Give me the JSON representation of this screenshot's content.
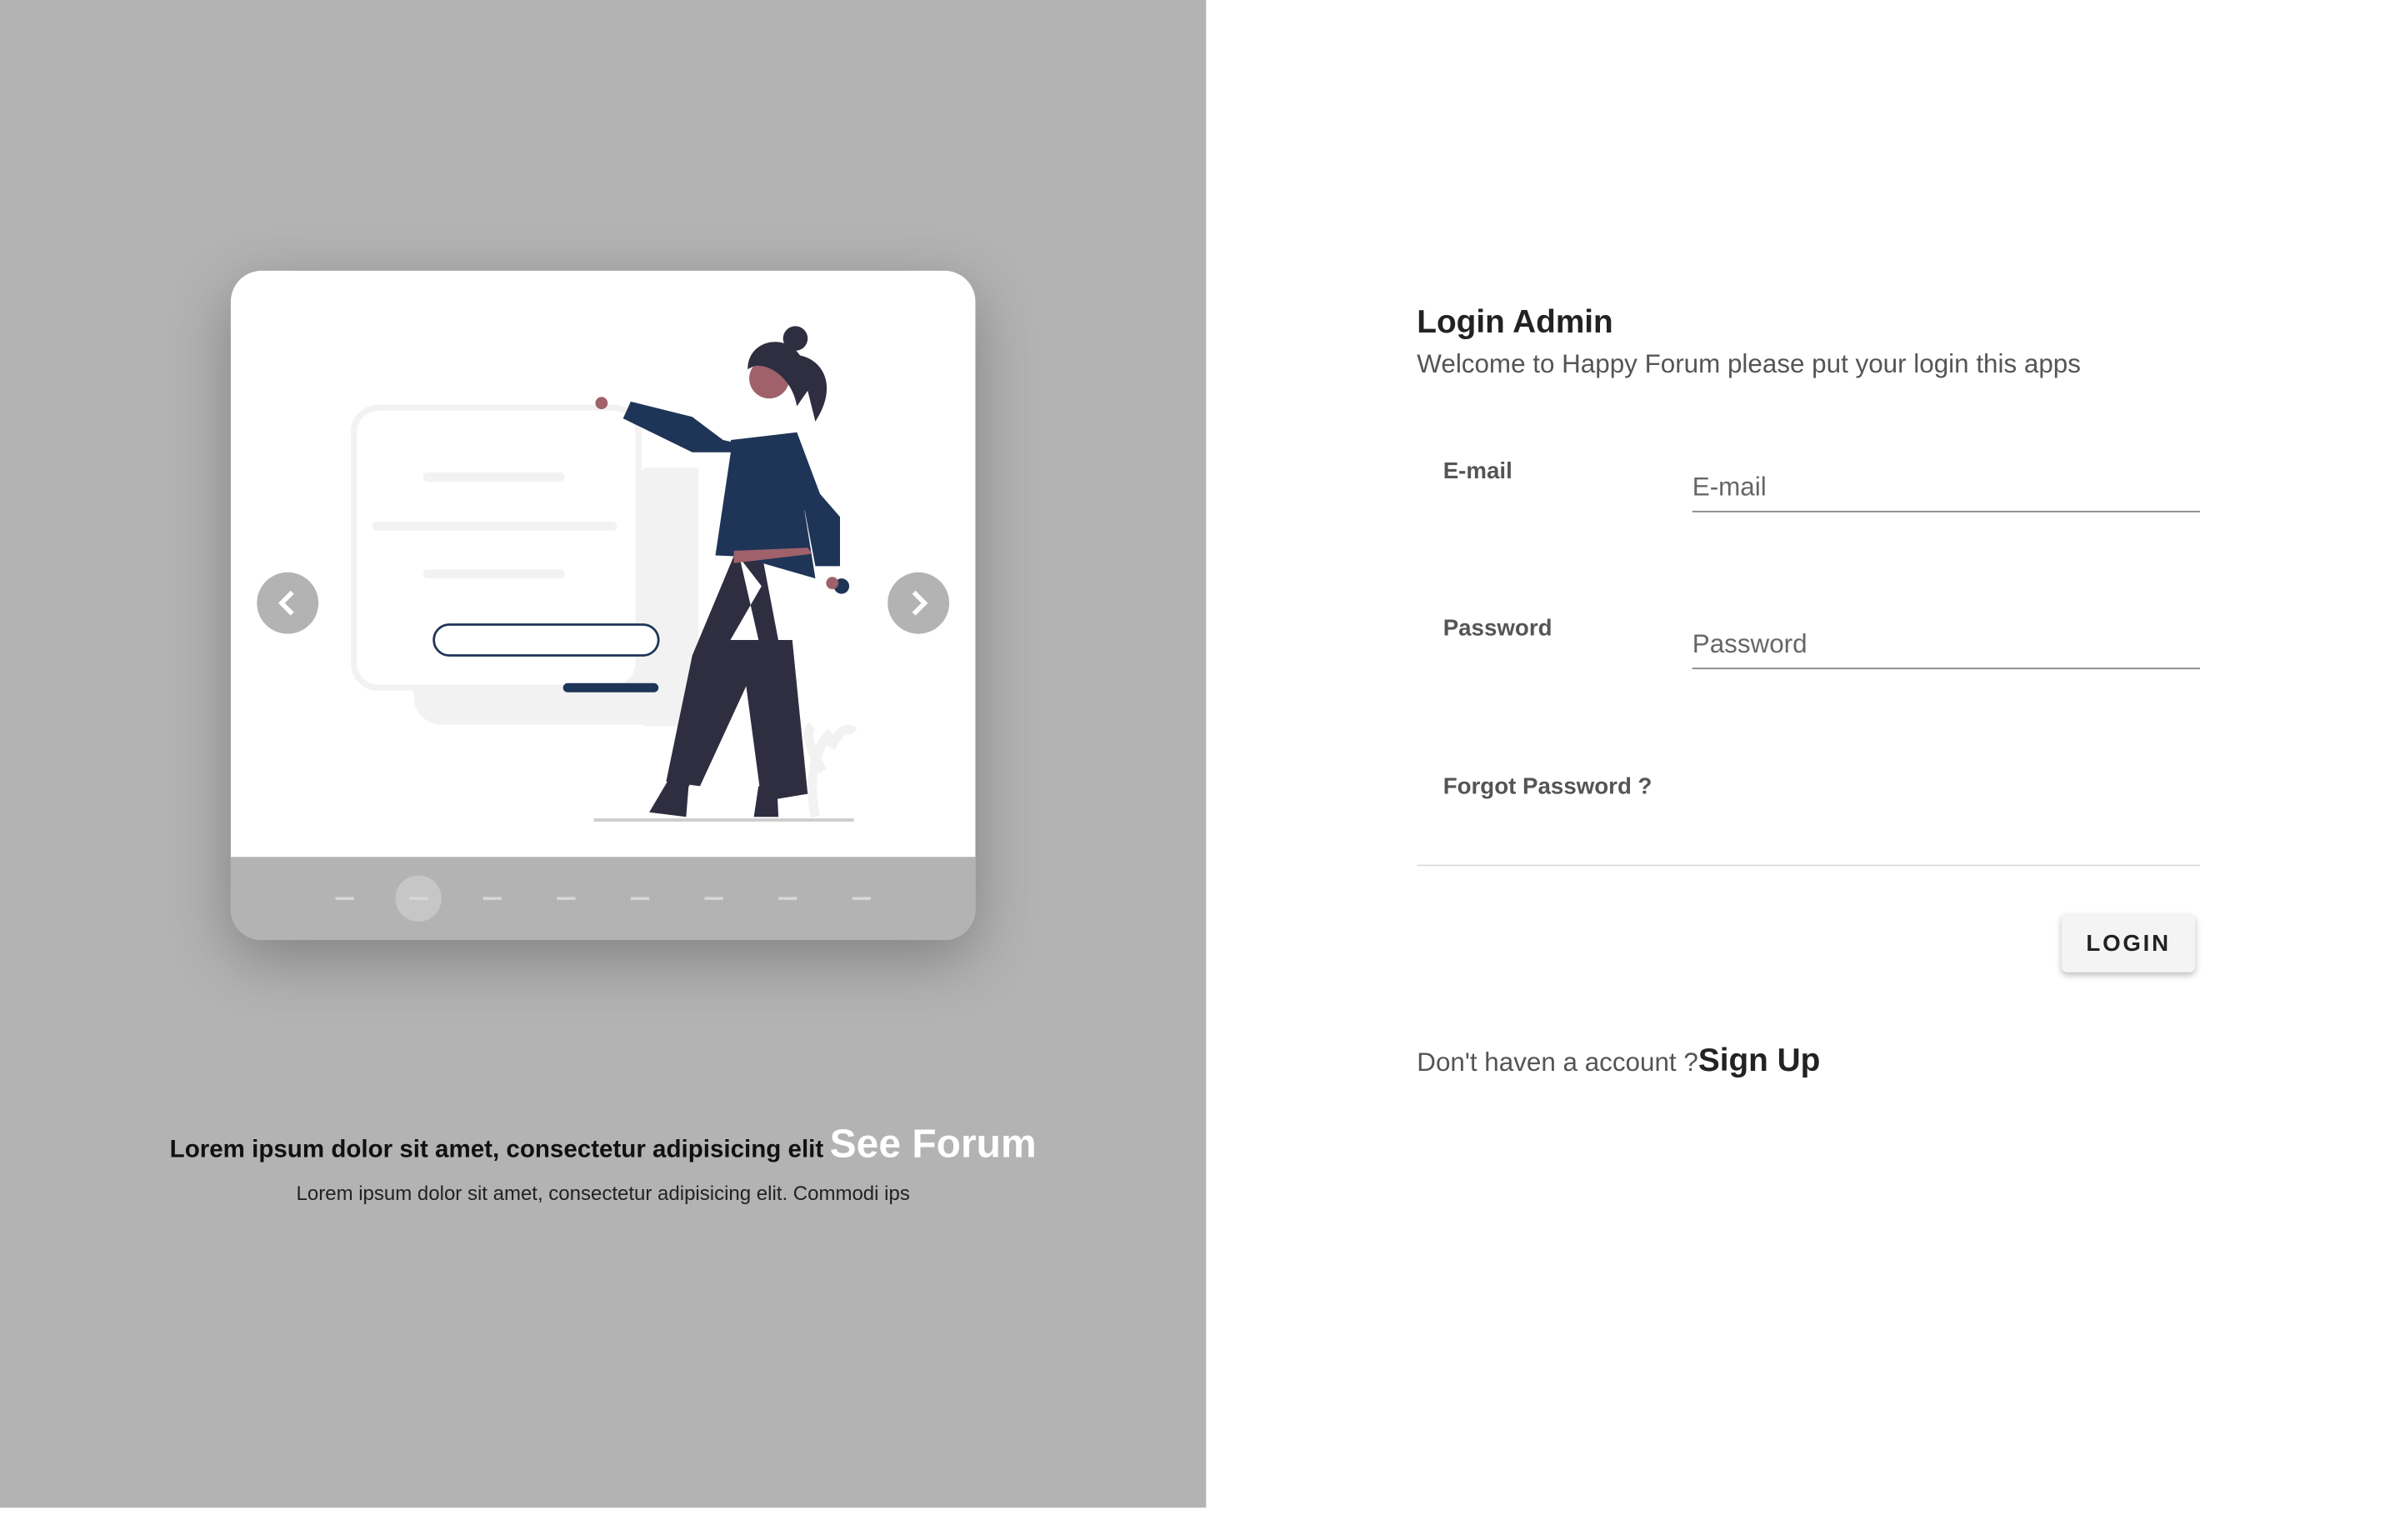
{
  "carousel": {
    "slide_count": 8,
    "active_index": 1,
    "prev_icon": "chevron-left-icon",
    "next_icon": "chevron-right-icon",
    "colors": {
      "shirt": "#1e3557",
      "pants": "#2f2e41",
      "skin": "#a0616a",
      "panel": "#b3b3b3"
    }
  },
  "caption": {
    "headline": "Lorem ipsum dolor sit amet, consectetur adipisicing elit",
    "link": "See Forum",
    "subtext": "Lorem ipsum dolor sit amet, consectetur adipisicing elit. Commodi ips"
  },
  "login": {
    "title": "Login Admin",
    "subtitle": "Welcome to Happy Forum please put your login this apps",
    "email_label": "E-mail",
    "email_placeholder": "E-mail",
    "email_value": "",
    "password_label": "Password",
    "password_placeholder": "Password",
    "password_value": "",
    "forgot": "Forgot Password ?",
    "button": "LOGIN",
    "no_account": "Don't haven a account ?",
    "signup": "Sign Up"
  }
}
